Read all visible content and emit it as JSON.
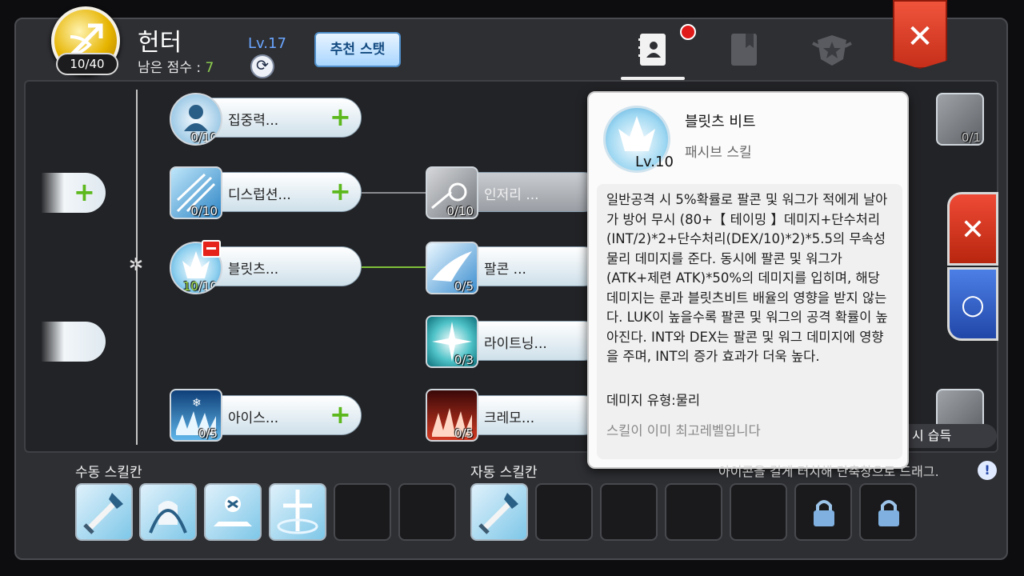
{
  "header": {
    "class_name": "헌터",
    "points_badge": "10/40",
    "remaining_label": "남은 점수 : ",
    "remaining_value": "7",
    "level": "Lv.17",
    "recommend_label": "추천 스탯",
    "tabs": [
      {
        "name": "skill-book-tab",
        "icon": "contact-book-icon",
        "active": true,
        "notification": true
      },
      {
        "name": "book-tab",
        "icon": "bookmark-book-icon",
        "active": false
      },
      {
        "name": "emblem-tab",
        "icon": "star-emblem-icon",
        "active": false
      }
    ],
    "close_icon": "close-icon"
  },
  "skills": [
    {
      "name": "집중력...",
      "level": "0/10",
      "icon": "focus-monk-icon",
      "addable": true
    },
    {
      "name": "디스럽션...",
      "level": "0/10",
      "icon": "arrow-burst-icon",
      "addable": true
    },
    {
      "name": "블릿츠...",
      "level_cur": "10",
      "level_max": "/10",
      "icon": "blitz-leaf-icon",
      "addable": false
    },
    {
      "name": "아이스...",
      "level": "0/5",
      "icon": "ice-trap-icon",
      "addable": true
    },
    {
      "name": "인저리 ...",
      "level": "0/10",
      "icon": "injury-burst-icon",
      "locked": true
    },
    {
      "name": "팔콘 ...",
      "level": "0/5",
      "icon": "falcon-icon"
    },
    {
      "name": "라이트닝...",
      "level": "0/3",
      "icon": "lightning-star-icon"
    },
    {
      "name": "크레모...",
      "level": "0/5",
      "icon": "cremo-fire-icon"
    }
  ],
  "right_column": {
    "top_level": "0/1",
    "acquire_text": "시 습득"
  },
  "tooltip": {
    "name": "블릿츠 비트",
    "type": "패시브 스킬",
    "level": "Lv.10",
    "description": "일반공격 시 5%확률로 팔콘 및 워그가 적에게 날아가 방어 무시 (80+【 테이밍 】데미지+단수처리(INT/2)*2+단수처리(DEX/10)*2)*5.5의 무속성 물리 데미지를 준다. 동시에 팔콘 및 워그가 (ATK+제련 ATK)*50%의 데미지를 입히며, 해당 데미지는 룬과 블릿츠비트 배율의 영향을 받지 않는다. LUK이 높을수록 팔콘 및 워그의 공격 확률이 높아진다. INT와 DEX는 팔콘 및 워그 데미지에 영향을 주며, INT의 증가 효과가 더욱 높다.",
    "damage_type": "데미지 유형:물리",
    "max_level_note": "스킬이 이미 최고레벨입니다"
  },
  "side_buttons": {
    "cancel": "✕",
    "confirm": "○"
  },
  "bottom": {
    "manual_label": "수동 스킬칸",
    "auto_label": "자동 스킬칸",
    "drag_hint": "아이콘을 길게 터치해 단축창으로 드래그.",
    "hint_icon": "!",
    "manual_slots": [
      "bash-sword-icon",
      "fist-guard-icon",
      "heal-figure-icon",
      "holy-cross-icon",
      "empty",
      "empty"
    ],
    "auto_slots": [
      "bash-sword-icon",
      "empty",
      "empty",
      "empty",
      "empty",
      "lock-icon",
      "lock-icon"
    ]
  }
}
